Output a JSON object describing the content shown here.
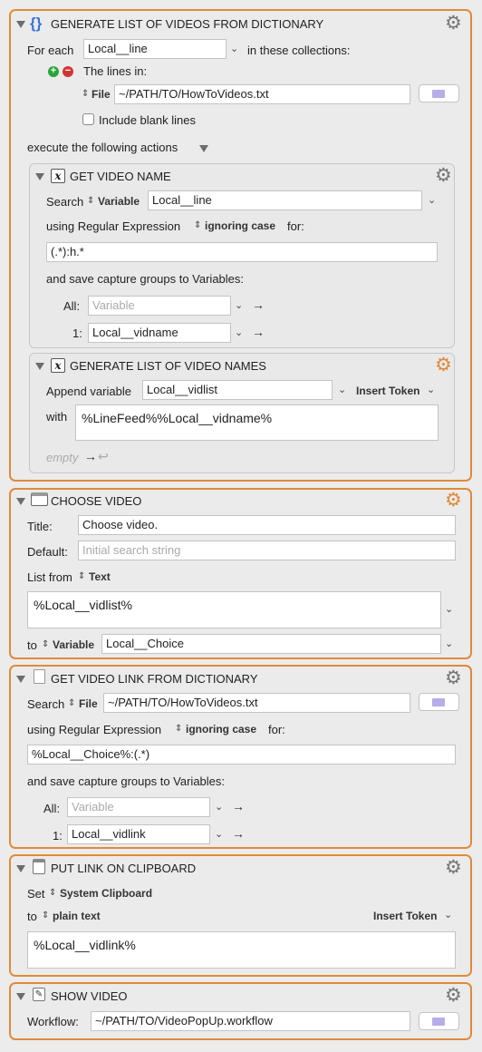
{
  "block1": {
    "title": "GENERATE LIST OF VIDEOS FROM DICTIONARY",
    "for_each_label": "For each",
    "for_each_var": "Local__line",
    "in_collections_label": "in these collections:",
    "lines_in_label": "The lines in:",
    "file_label": "File",
    "file_path": "~/PATH/TO/HowToVideos.txt",
    "include_blank_label": "Include blank lines",
    "execute_label": "execute the following actions",
    "sub1": {
      "title": "GET VIDEO NAME",
      "search_label": "Search",
      "variable_label": "Variable",
      "variable_value": "Local__line",
      "using_label": "using Regular Expression",
      "case_label": "ignoring case",
      "for_label": "for:",
      "regex": "(.*):h.*",
      "save_label": "and save capture groups to Variables:",
      "all_label": "All:",
      "all_placeholder": "Variable",
      "one_label": "1:",
      "one_value": "Local__vidname"
    },
    "sub2": {
      "title": "GENERATE LIST OF VIDEO NAMES",
      "append_label": "Append variable",
      "append_value": "Local__vidlist",
      "insert_token_label": "Insert Token",
      "with_label": "with",
      "with_value": "%LineFeed%%Local__vidname%"
    },
    "empty_label": "empty"
  },
  "block2": {
    "title": "CHOOSE VIDEO",
    "title_label": "Title:",
    "title_value": "Choose video.",
    "default_label": "Default:",
    "default_placeholder": "Initial search string",
    "list_from_label": "List from",
    "text_label": "Text",
    "list_value": "%Local__vidlist%",
    "to_label": "to",
    "variable_label": "Variable",
    "variable_value": "Local__Choice"
  },
  "block3": {
    "title": "GET VIDEO LINK FROM DICTIONARY",
    "search_label": "Search",
    "file_label": "File",
    "file_path": "~/PATH/TO/HowToVideos.txt",
    "using_label": "using Regular Expression",
    "case_label": "ignoring case",
    "for_label": "for:",
    "regex": "%Local__Choice%:(.*)",
    "save_label": "and save capture groups to Variables:",
    "all_label": "All:",
    "all_placeholder": "Variable",
    "one_label": "1:",
    "one_value": "Local__vidlink"
  },
  "block4": {
    "title": "PUT LINK ON CLIPBOARD",
    "set_label": "Set",
    "clipboard_label": "System Clipboard",
    "to_label": "to",
    "plain_text_label": "plain text",
    "insert_token_label": "Insert Token",
    "value": "%Local__vidlink%"
  },
  "block5": {
    "title": "SHOW VIDEO",
    "workflow_label": "Workflow:",
    "workflow_path": "~/PATH/TO/VideoPopUp.workflow"
  },
  "colors": {
    "accent_border": "#e08a3a",
    "add": "#29a53a",
    "remove": "#d03636",
    "folder": "#b6aee8"
  },
  "icons": [
    "disclosure-triangle-icon",
    "gear-icon",
    "curly-braces-icon",
    "variable-x-icon",
    "window-icon",
    "document-icon",
    "clipboard-icon",
    "script-icon",
    "folder-icon",
    "add-icon",
    "remove-icon",
    "return-arrow-icon"
  ]
}
